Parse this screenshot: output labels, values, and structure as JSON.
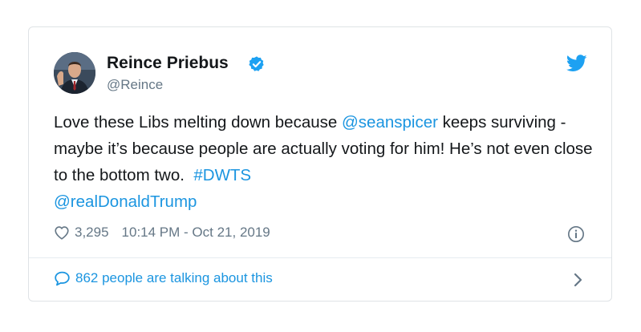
{
  "tweet": {
    "author_name": "Reince Priebus",
    "author_handle": "@Reince",
    "verified": true,
    "text_parts": [
      "Love these Libs melting down because ",
      "@seanspicer",
      " keeps surviving - maybe it’s because people are actually voting for him! He’s not even close to the bottom two. ",
      "#DWTS",
      "@realDonaldTrump"
    ],
    "likes": "3,295",
    "timestamp": "10:14 PM - Oct 21, 2019",
    "talking": "862 people are talking about this"
  },
  "icons": {
    "verified": "verified-badge-icon",
    "twitter": "twitter-bird-icon",
    "like": "heart-icon",
    "info": "info-icon",
    "reply": "speech-bubble-icon",
    "more": "chevron-right-icon"
  },
  "colors": {
    "link": "#1b95e0",
    "text": "#14171a",
    "muted": "#657786",
    "border": "#dfe3e6"
  }
}
